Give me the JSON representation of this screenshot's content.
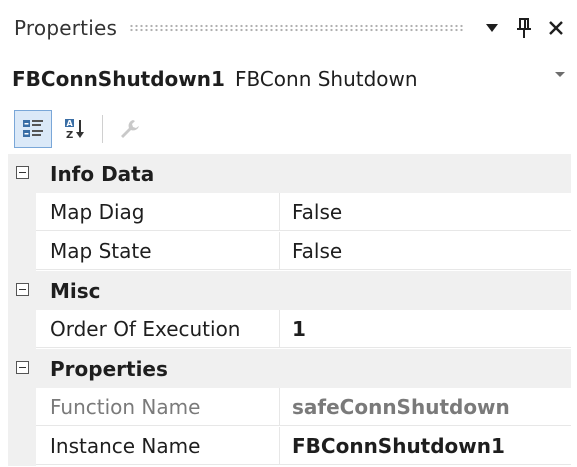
{
  "window": {
    "title": "Properties",
    "menu_icon": "dropdown-arrow-icon",
    "pin_icon": "pin-icon",
    "close_icon": "close-icon"
  },
  "selector": {
    "object_name": "FBConnShutdown1",
    "object_type": "FBConn Shutdown"
  },
  "toolbar": {
    "buttons": [
      {
        "name": "categorized",
        "icon": "categorized-icon",
        "active": true
      },
      {
        "name": "alphabetical",
        "icon": "sort-az-icon",
        "active": false
      },
      {
        "name": "property-pages",
        "icon": "wrench-icon",
        "active": false,
        "disabled": true
      }
    ]
  },
  "categories": [
    {
      "label": "Info Data",
      "properties": [
        {
          "name": "Map Diag",
          "value": "False"
        },
        {
          "name": "Map State",
          "value": "False"
        }
      ]
    },
    {
      "label": "Misc",
      "properties": [
        {
          "name": "Order Of Execution",
          "value": "1"
        }
      ]
    },
    {
      "label": "Properties",
      "properties": [
        {
          "name": "Function Name",
          "value": "safeConnShutdown"
        },
        {
          "name": "Instance Name",
          "value": "FBConnShutdown1"
        }
      ]
    }
  ],
  "colors": {
    "category_background": "#f0f0f0",
    "active_button_border": "#7aa7d8",
    "active_button_fill": "#dbe9f8",
    "readonly_text": "#7a7a7a"
  }
}
